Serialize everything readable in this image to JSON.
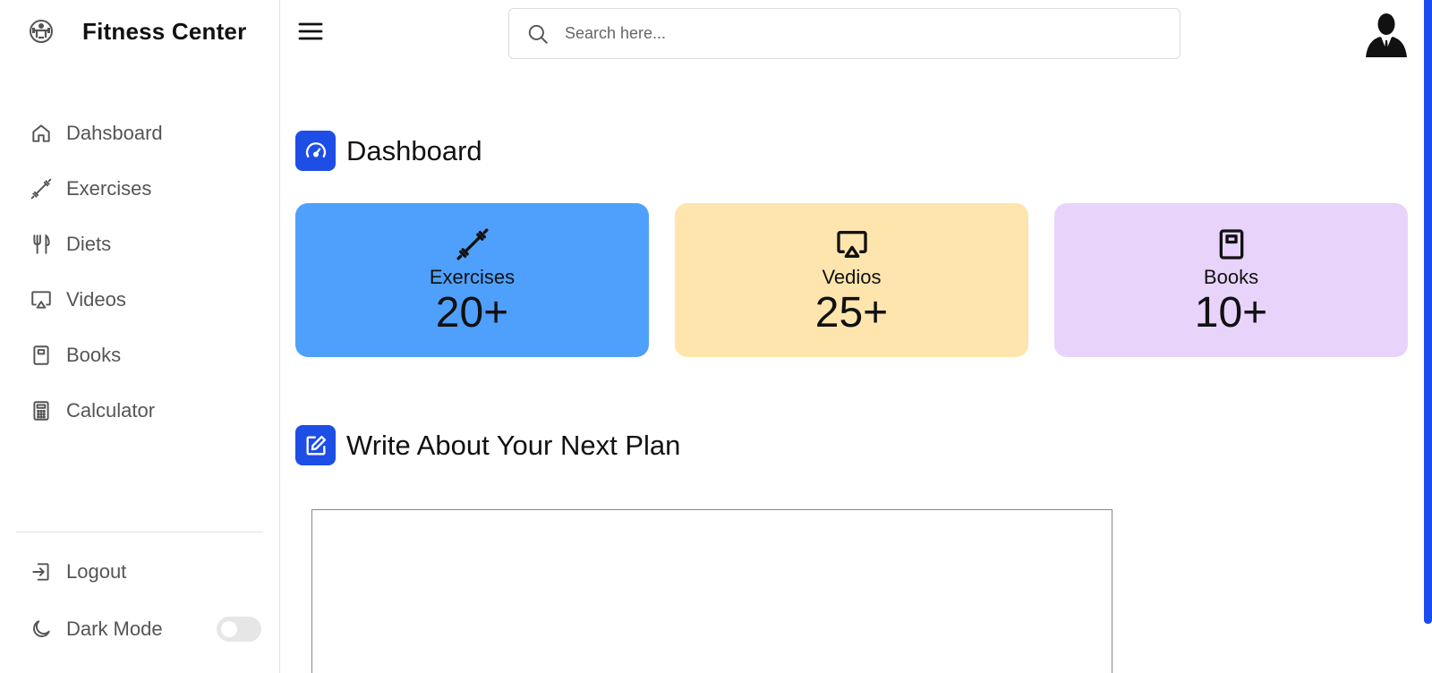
{
  "brand": {
    "title": "Fitness Center",
    "logo_icon": "gym-logo-icon"
  },
  "sidebar": {
    "items": [
      {
        "label": "Dahsboard",
        "icon": "home-icon"
      },
      {
        "label": "Exercises",
        "icon": "dumbbell-icon"
      },
      {
        "label": "Diets",
        "icon": "fork-knife-icon"
      },
      {
        "label": "Videos",
        "icon": "screen-cast-icon"
      },
      {
        "label": "Books",
        "icon": "book-icon"
      },
      {
        "label": "Calculator",
        "icon": "calculator-icon"
      }
    ],
    "logout_label": "Logout",
    "dark_mode_label": "Dark Mode",
    "dark_mode_on": false
  },
  "header": {
    "search_placeholder": "Search here...",
    "search_value": ""
  },
  "dashboard": {
    "title": "Dashboard",
    "cards": [
      {
        "label": "Exercises",
        "value": "20+",
        "color": "#4fa0fc",
        "icon": "dumbbell-icon"
      },
      {
        "label": "Vedios",
        "value": "25+",
        "color": "#fde5ad",
        "icon": "screen-cast-icon"
      },
      {
        "label": "Books",
        "value": "10+",
        "color": "#e8d4fb",
        "icon": "book-icon"
      }
    ]
  },
  "plan": {
    "title": "Write About Your Next Plan",
    "text": ""
  },
  "colors": {
    "accent": "#1d4ee6",
    "scrollbar": "#1a4df0"
  }
}
